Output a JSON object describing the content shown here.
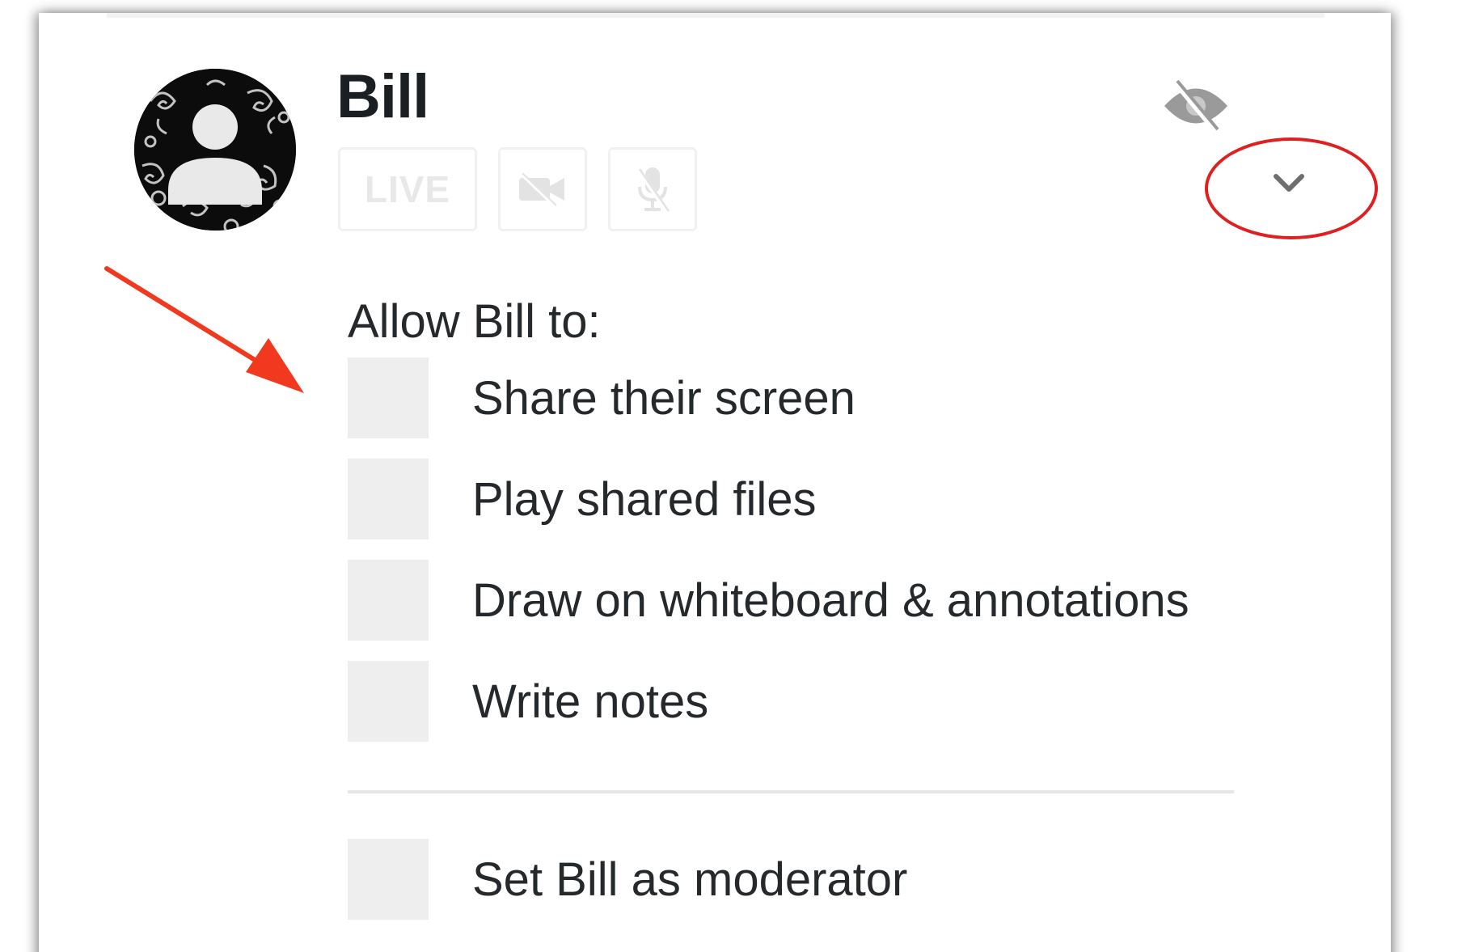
{
  "user": {
    "name": "Bill",
    "avatar_icon": "user-avatar-icon"
  },
  "status": {
    "live_label": "LIVE",
    "camera_icon": "camera-off-icon",
    "mic_icon": "mic-off-icon",
    "visibility_icon": "eye-off-icon"
  },
  "dropdown": {
    "icon": "chevron-down-icon"
  },
  "permissions": {
    "heading": "Allow Bill to:",
    "items": [
      {
        "label": "Share their screen",
        "checked": false
      },
      {
        "label": "Play shared files",
        "checked": false
      },
      {
        "label": "Draw on whiteboard & annotations",
        "checked": false
      },
      {
        "label": "Write notes",
        "checked": false
      }
    ],
    "moderator": {
      "label": "Set Bill as moderator",
      "checked": false
    }
  },
  "annotations": {
    "highlight_color": "#e02020",
    "arrow_color": "#f0391e"
  },
  "colors": {
    "text": "#26292c",
    "checkbox_bg": "#eeeeee",
    "muted_icon": "#e3e3e3"
  }
}
